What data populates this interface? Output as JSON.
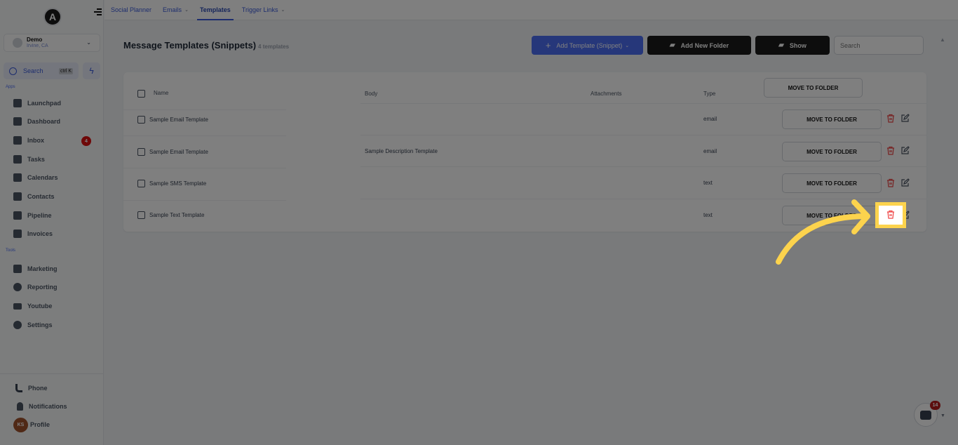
{
  "sidebar": {
    "logo_letter": "A",
    "account": {
      "name": "Demo",
      "location": "Irvine, CA"
    },
    "search": {
      "label": "Search",
      "shortcut": "ctrl K"
    },
    "apps_section": "Apps",
    "apps": [
      {
        "label": "Launchpad",
        "icon": "rocket-icon"
      },
      {
        "label": "Dashboard",
        "icon": "grid-icon"
      },
      {
        "label": "Inbox",
        "icon": "inbox-icon",
        "badge": "4"
      },
      {
        "label": "Tasks",
        "icon": "clipboard-icon"
      },
      {
        "label": "Calendars",
        "icon": "calendar-icon"
      },
      {
        "label": "Contacts",
        "icon": "person-icon"
      },
      {
        "label": "Pipeline",
        "icon": "funnel-icon"
      },
      {
        "label": "Invoices",
        "icon": "invoice-icon"
      }
    ],
    "tools_section": "Tools",
    "tools": [
      {
        "label": "Marketing",
        "icon": "megaphone-icon"
      },
      {
        "label": "Reporting",
        "icon": "pie-chart-icon"
      },
      {
        "label": "Youtube",
        "icon": "youtube-icon"
      },
      {
        "label": "Settings",
        "icon": "gear-icon"
      }
    ],
    "bottom": [
      {
        "label": "Phone",
        "icon": "phone-icon"
      },
      {
        "label": "Notifications",
        "icon": "bell-icon"
      },
      {
        "label": "Profile",
        "initials": "KS"
      }
    ]
  },
  "topnav": {
    "items": [
      {
        "label": "Social Planner",
        "dropdown": false,
        "active": false
      },
      {
        "label": "Emails",
        "dropdown": true,
        "active": false
      },
      {
        "label": "Templates",
        "dropdown": false,
        "active": true
      },
      {
        "label": "Trigger Links",
        "dropdown": true,
        "active": false
      }
    ]
  },
  "header": {
    "title": "Message Templates (Snippets)",
    "count": "4 templates",
    "add_template_label": "Add Template (Snippet)",
    "add_folder_label": "Add New Folder",
    "show_label": "Show",
    "search_placeholder": "Search"
  },
  "table": {
    "columns": {
      "name": "Name",
      "body": "Body",
      "attachments": "Attachments",
      "type": "Type"
    },
    "bulk_action_label": "MOVE TO FOLDER",
    "rows": [
      {
        "name": "Sample Email Template",
        "body": "",
        "attachments": "",
        "type": "email",
        "action": "MOVE TO FOLDER"
      },
      {
        "name": "Sample Email Template",
        "body": "Sample Description Template",
        "attachments": "",
        "type": "email",
        "action": "MOVE TO FOLDER"
      },
      {
        "name": "Sample SMS Template",
        "body": "",
        "attachments": "",
        "type": "text",
        "action": "MOVE TO FOLDER"
      },
      {
        "name": "Sample Text Template",
        "body": "",
        "attachments": "",
        "type": "text",
        "action": "MOVE TO FOLDER"
      }
    ]
  },
  "chat_widget": {
    "badge": "14"
  },
  "colors": {
    "accent": "#4c6ef5",
    "danger": "#ef4444",
    "highlight": "#fcd34d",
    "dark_button": "#1a1a1a"
  }
}
